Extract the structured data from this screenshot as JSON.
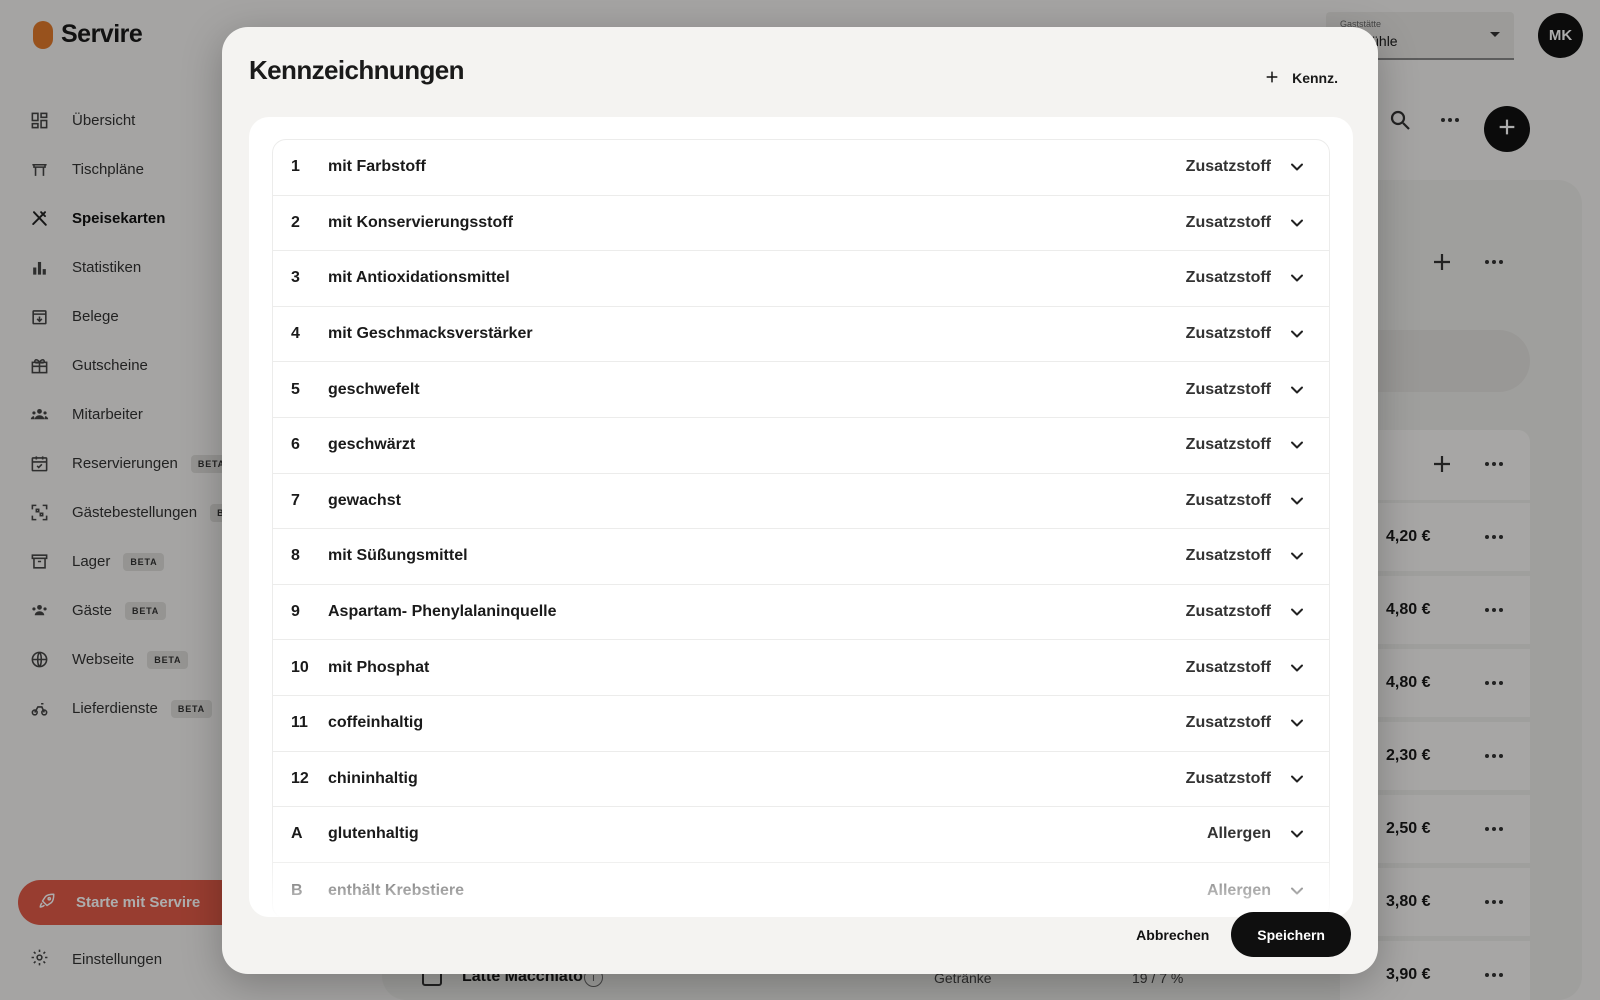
{
  "app": {
    "name": "Servire",
    "venue_select": {
      "label": "Gaststätte",
      "value": "en Mühle"
    },
    "avatar_initials": "MK"
  },
  "sidebar": {
    "items": [
      {
        "label": "Übersicht",
        "icon": "dashboard-icon",
        "active": false,
        "beta": ""
      },
      {
        "label": "Tischpläne",
        "icon": "table-icon",
        "active": false,
        "beta": ""
      },
      {
        "label": "Speisekarten",
        "icon": "cutlery-icon",
        "active": true,
        "beta": ""
      },
      {
        "label": "Statistiken",
        "icon": "bar-chart-icon",
        "active": false,
        "beta": ""
      },
      {
        "label": "Belege",
        "icon": "receipt-icon",
        "active": false,
        "beta": ""
      },
      {
        "label": "Gutscheine",
        "icon": "gift-icon",
        "active": false,
        "beta": ""
      },
      {
        "label": "Mitarbeiter",
        "icon": "people-icon",
        "active": false,
        "beta": ""
      },
      {
        "label": "Reservierungen",
        "icon": "calendar-icon",
        "active": false,
        "beta": "BETA"
      },
      {
        "label": "Gästebestellungen",
        "icon": "qr-code-icon",
        "active": false,
        "beta": "BET"
      },
      {
        "label": "Lager",
        "icon": "archive-icon",
        "active": false,
        "beta": "BETA"
      },
      {
        "label": "Gäste",
        "icon": "guests-icon",
        "active": false,
        "beta": "BETA"
      },
      {
        "label": "Webseite",
        "icon": "globe-icon",
        "active": false,
        "beta": "BETA"
      },
      {
        "label": "Lieferdienste",
        "icon": "delivery-icon",
        "active": false,
        "beta": "BETA"
      }
    ],
    "cta_label": "Starte mit Servire",
    "settings_label": "Einstellungen"
  },
  "background": {
    "prices": [
      "4,20 €",
      "4,80 €",
      "4,80 €",
      "2,30 €",
      "2,50 €",
      "3,80 €",
      "3,90 €"
    ],
    "bottom_row": {
      "name": "Latte Macchiato",
      "category": "Getränke",
      "tax": "19 / 7 %",
      "info_glyph": "i"
    }
  },
  "modal": {
    "title": "Kennzeichnungen",
    "add_label": "Kennz.",
    "rows": [
      {
        "code": "1",
        "name": "mit Farbstoff",
        "type": "Zusatzstoff"
      },
      {
        "code": "2",
        "name": "mit Konservierungsstoff",
        "type": "Zusatzstoff"
      },
      {
        "code": "3",
        "name": "mit Antioxidationsmittel",
        "type": "Zusatzstoff"
      },
      {
        "code": "4",
        "name": "mit Geschmacksverstärker",
        "type": "Zusatzstoff"
      },
      {
        "code": "5",
        "name": "geschwefelt",
        "type": "Zusatzstoff"
      },
      {
        "code": "6",
        "name": "geschwärzt",
        "type": "Zusatzstoff"
      },
      {
        "code": "7",
        "name": "gewachst",
        "type": "Zusatzstoff"
      },
      {
        "code": "8",
        "name": "mit Süßungsmittel",
        "type": "Zusatzstoff"
      },
      {
        "code": "9",
        "name": "Aspartam- Phenylalaninquelle",
        "type": "Zusatzstoff"
      },
      {
        "code": "10",
        "name": "mit Phosphat",
        "type": "Zusatzstoff"
      },
      {
        "code": "11",
        "name": "coffeinhaltig",
        "type": "Zusatzstoff"
      },
      {
        "code": "12",
        "name": "chininhaltig",
        "type": "Zusatzstoff"
      },
      {
        "code": "A",
        "name": "glutenhaltig",
        "type": "Allergen"
      },
      {
        "code": "B",
        "name": "enthält Krebstiere",
        "type": "Allergen"
      }
    ],
    "cancel_label": "Abbrechen",
    "save_label": "Speichern"
  },
  "colors": {
    "accent": "#e07a2c",
    "cta": "#e05a48",
    "primary_button": "#0f0f0f"
  }
}
